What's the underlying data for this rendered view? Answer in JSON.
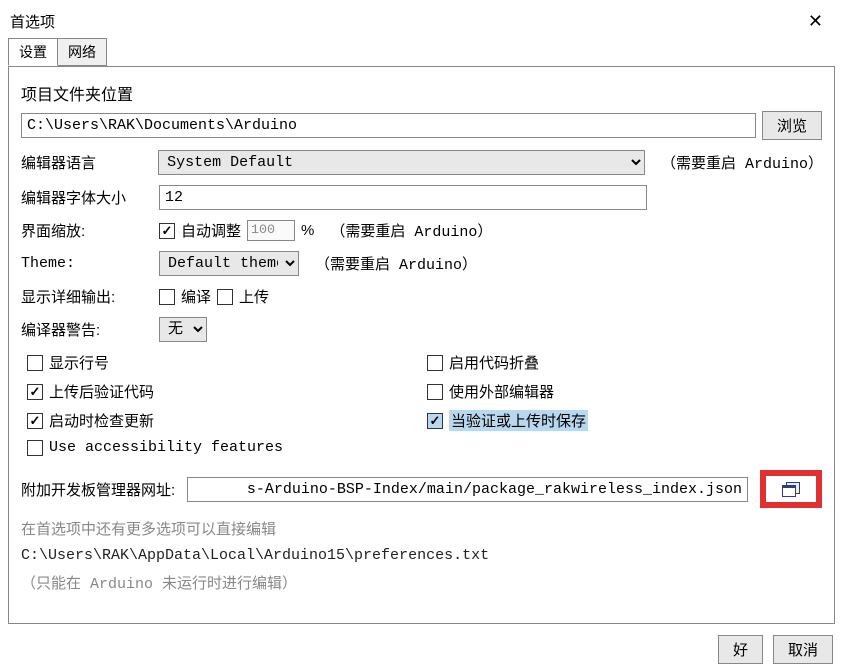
{
  "window": {
    "title": "首选项"
  },
  "tabs": {
    "settings": "设置",
    "network": "网络"
  },
  "sketchbook": {
    "label": "项目文件夹位置",
    "path": "C:\\Users\\RAK\\Documents\\Arduino",
    "browse": "浏览"
  },
  "editor": {
    "lang_label": "编辑器语言",
    "lang_value": "System Default",
    "lang_hint": "（需要重启 Arduino）",
    "font_label": "编辑器字体大小",
    "font_value": "12"
  },
  "scale": {
    "label": "界面缩放:",
    "auto_label": "自动调整",
    "value": "100",
    "percent": "%",
    "hint": "（需要重启 Arduino）"
  },
  "theme": {
    "label": "Theme:",
    "value": "Default theme",
    "hint": "（需要重启 Arduino）"
  },
  "verbose": {
    "label": "显示详细输出:",
    "compile": "编译",
    "upload": "上传"
  },
  "warnings": {
    "label": "编译器警告:",
    "value": "无"
  },
  "checks": {
    "line_numbers": "显示行号",
    "code_folding": "启用代码折叠",
    "verify_upload": "上传后验证代码",
    "external_editor": "使用外部编辑器",
    "check_updates": "启动时检查更新",
    "save_verify": "当验证或上传时保存",
    "accessibility": "Use accessibility features"
  },
  "boards_url": {
    "label": "附加开发板管理器网址:",
    "value": "s-Arduino-BSP-Index/main/package_rakwireless_index.json"
  },
  "more_prefs": {
    "hint": "在首选项中还有更多选项可以直接编辑",
    "path": "C:\\Users\\RAK\\AppData\\Local\\Arduino15\\preferences.txt",
    "note": "（只能在 Arduino 未运行时进行编辑）"
  },
  "buttons": {
    "ok": "好",
    "cancel": "取消"
  }
}
